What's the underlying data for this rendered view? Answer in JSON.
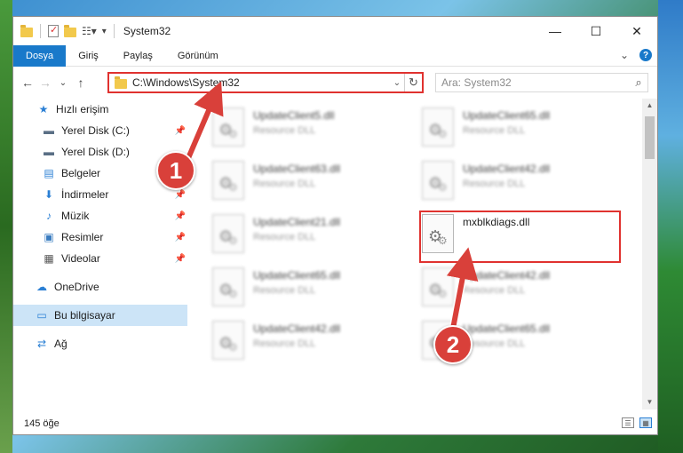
{
  "window": {
    "title": "System32",
    "controls": {
      "minimize": "—",
      "maximize": "☐",
      "close": "✕"
    }
  },
  "ribbon": {
    "tabs": [
      "Dosya",
      "Giriş",
      "Paylaş",
      "Görünüm"
    ],
    "expand_icon": "⌄",
    "help": "?"
  },
  "nav": {
    "back": "←",
    "forward": "→",
    "recent": "⌄",
    "up": "↑",
    "address": "C:\\Windows\\System32",
    "search_placeholder": "Ara: System32"
  },
  "sidebar": {
    "items": [
      {
        "label": "Hızlı erişim",
        "icon": "star-icon",
        "glyph": "★",
        "color": "#2a7fd4"
      },
      {
        "label": "Yerel Disk (C:)",
        "icon": "drive-icon",
        "glyph": "▬",
        "color": "#5a6f85",
        "pinned": true
      },
      {
        "label": "Yerel Disk (D:)",
        "icon": "drive-icon",
        "glyph": "▬",
        "color": "#5a6f85"
      },
      {
        "label": "Belgeler",
        "icon": "documents-icon",
        "glyph": "▤",
        "color": "#2a7fd4",
        "pinned": true
      },
      {
        "label": "İndirmeler",
        "icon": "downloads-icon",
        "glyph": "⬇",
        "color": "#2a7fd4",
        "pinned": true
      },
      {
        "label": "Müzik",
        "icon": "music-icon",
        "glyph": "♪",
        "color": "#2a7fd4",
        "pinned": true
      },
      {
        "label": "Resimler",
        "icon": "pictures-icon",
        "glyph": "▣",
        "color": "#3a7cc0",
        "pinned": true
      },
      {
        "label": "Videolar",
        "icon": "videos-icon",
        "glyph": "▦",
        "color": "#555",
        "pinned": true
      },
      {
        "label": "OneDrive",
        "icon": "onedrive-icon",
        "glyph": "☁",
        "color": "#2a7fd4"
      },
      {
        "label": "Bu bilgisayar",
        "icon": "computer-icon",
        "glyph": "▭",
        "color": "#2a7fd4",
        "selected": true
      },
      {
        "label": "Ağ",
        "icon": "network-icon",
        "glyph": "⇄",
        "color": "#2a7fd4"
      }
    ]
  },
  "files": [
    {
      "name": "UpdateClient5.dll",
      "type": "Resource DLL"
    },
    {
      "name": "UpdateClient65.dll",
      "type": "Resource DLL"
    },
    {
      "name": "UpdateClient63.dll",
      "type": "Resource DLL"
    },
    {
      "name": "UpdateClient42.dll",
      "type": "Resource DLL"
    },
    {
      "name": "UpdateClient21.dll",
      "type": "Resource DLL"
    },
    {
      "name": "mxblkdiags.dll",
      "type": ""
    },
    {
      "name": "UpdateClient65.dll",
      "type": "Resource DLL"
    },
    {
      "name": "UpdateClient42.dll",
      "type": "Resource DLL"
    },
    {
      "name": "UpdateClient42.dll",
      "type": "Resource DLL"
    },
    {
      "name": "UpdateClient65.dll",
      "type": "Resource DLL"
    }
  ],
  "status": {
    "count": "145 öğe"
  },
  "callouts": [
    "1",
    "2"
  ]
}
